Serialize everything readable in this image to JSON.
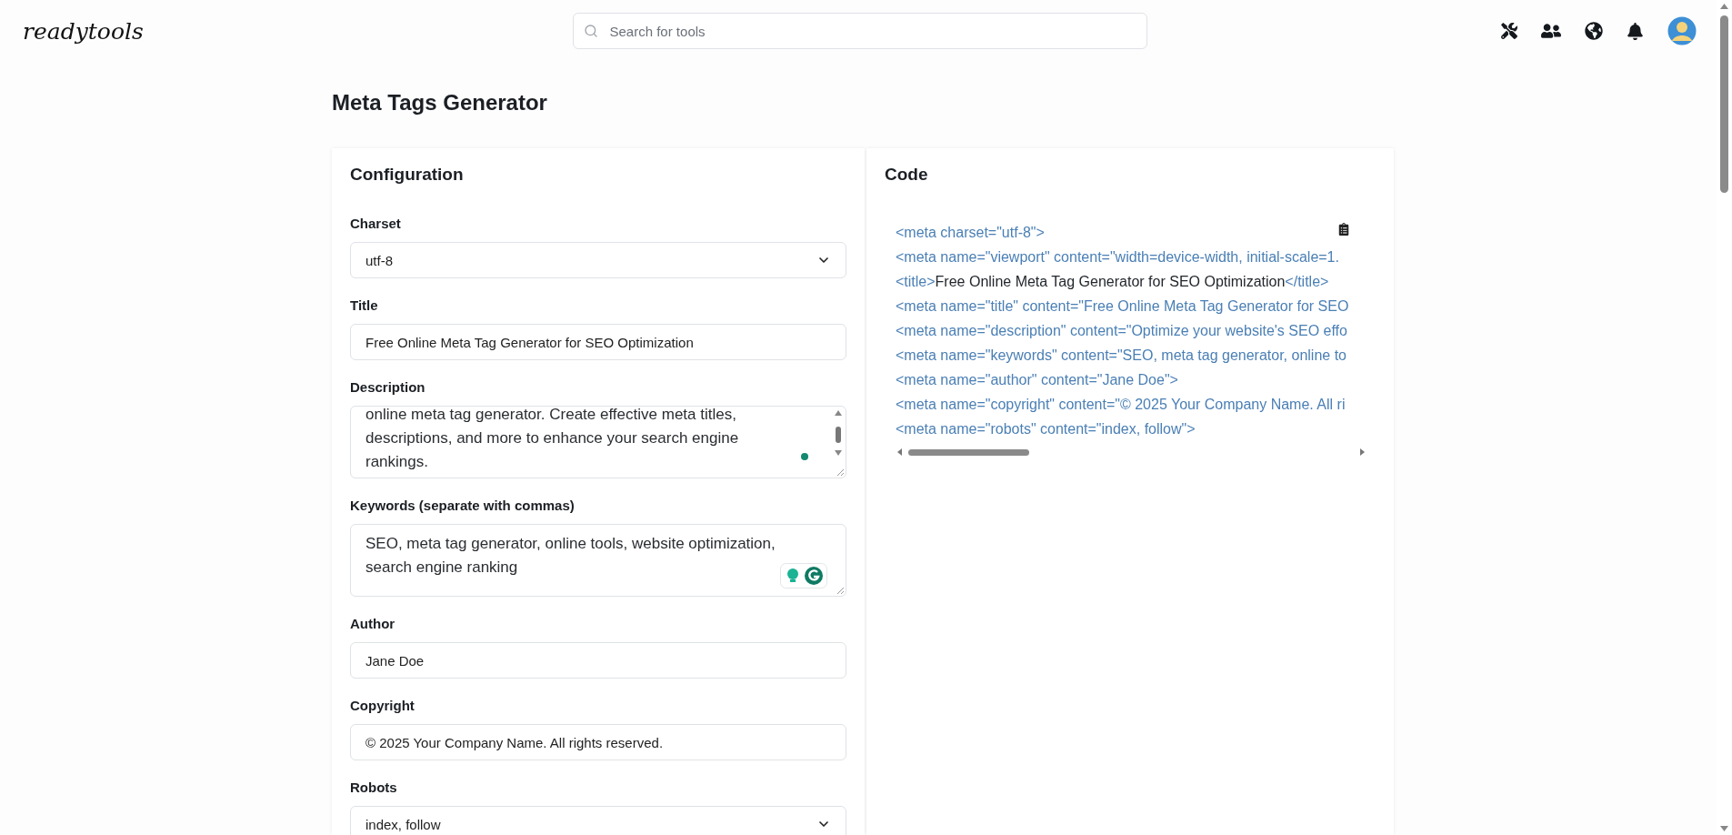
{
  "header": {
    "logo": "readytools",
    "search": {
      "placeholder": "Search for tools"
    }
  },
  "page_title": "Meta Tags Generator",
  "configuration": {
    "title": "Configuration",
    "fields": [
      {
        "kind": "select",
        "label": "Charset",
        "value": "utf-8"
      },
      {
        "kind": "input",
        "label": "Title",
        "value": "Free Online Meta Tag Generator for SEO Optimization"
      },
      {
        "kind": "textarea",
        "label": "Description",
        "value": "online meta tag generator. Create effective meta titles, descriptions, and more to enhance your search engine rankings.",
        "scrolled": true
      },
      {
        "kind": "textarea",
        "label": "Keywords (separate with commas)",
        "value": "SEO, meta tag generator, online tools, website optimization, search engine ranking",
        "scrolled": false
      },
      {
        "kind": "input",
        "label": "Author",
        "value": "Jane Doe"
      },
      {
        "kind": "input",
        "label": "Copyright",
        "value": "© 2025 Your Company Name. All rights reserved."
      },
      {
        "kind": "select",
        "label": "Robots",
        "value": "index, follow"
      }
    ]
  },
  "code": {
    "title": "Code",
    "lines": [
      [
        {
          "kind": "tag",
          "text": "<meta charset=\"utf-8\">"
        }
      ],
      [
        {
          "kind": "tag",
          "text": "<meta name=\"viewport\" content=\"width=device-width, initial-scale=1."
        }
      ],
      [
        {
          "kind": "tag",
          "text": "<title>"
        },
        {
          "kind": "text",
          "text": "Free Online Meta Tag Generator for SEO Optimization"
        },
        {
          "kind": "tag",
          "text": "</title>"
        }
      ],
      [
        {
          "kind": "tag",
          "text": "<meta name=\"title\" content=\"Free Online Meta Tag Generator for SEO"
        }
      ],
      [
        {
          "kind": "tag",
          "text": "<meta name=\"description\" content=\"Optimize your website's SEO effo"
        }
      ],
      [
        {
          "kind": "tag",
          "text": "<meta name=\"keywords\" content=\"SEO, meta tag generator, online to"
        }
      ],
      [
        {
          "kind": "tag",
          "text": "<meta name=\"author\" content=\"Jane Doe\">"
        }
      ],
      [
        {
          "kind": "tag",
          "text": "<meta name=\"copyright\" content=\"© 2025 Your Company Name. All ri"
        }
      ],
      [
        {
          "kind": "tag",
          "text": "<meta name=\"robots\" content=\"index, follow\">"
        }
      ]
    ]
  }
}
